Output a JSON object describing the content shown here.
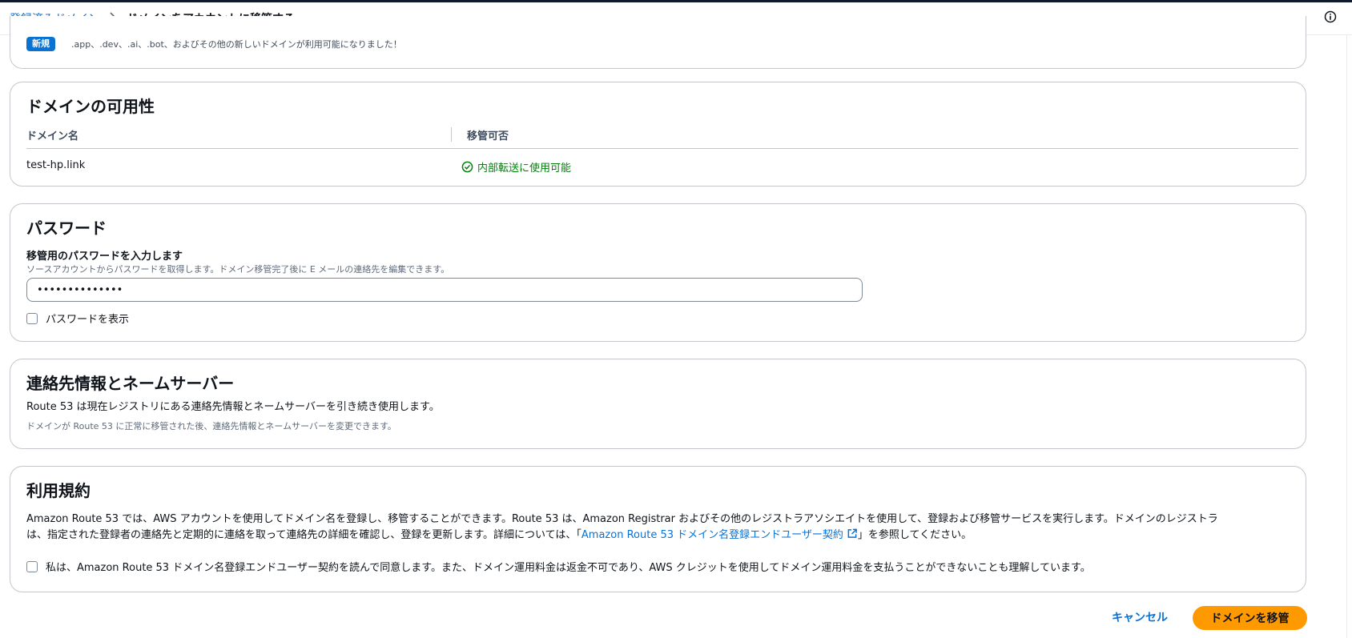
{
  "breadcrumb": {
    "parent": "登録済みドメイン",
    "current": "ドメインをアカウントに移管する"
  },
  "icons": {
    "info": "info-icon",
    "chevron": "chevron-right-icon",
    "status_ok": "check-circle-icon",
    "external": "external-link-icon"
  },
  "colors": {
    "accent": "#0972d3",
    "success": "#037f0c",
    "primary_button": "#ff9900"
  },
  "announcement": {
    "badge": "新規",
    "text": ".app、.dev、.ai、.bot、およびその他の新しいドメインが利用可能になりました！"
  },
  "availability": {
    "title": "ドメインの可用性",
    "columns": [
      "ドメイン名",
      "移管可否"
    ],
    "rows": [
      {
        "domain": "test-hp.link",
        "status": "内部転送に使用可能"
      }
    ]
  },
  "password": {
    "title": "パスワード",
    "label": "移管用のパスワードを入力します",
    "description": "ソースアカウントからパスワードを取得します。ドメイン移管完了後に E メールの連絡先を編集できます。",
    "value": "••••••••••••••",
    "show_label": "パスワードを表示"
  },
  "contacts": {
    "title": "連絡先情報とネームサーバー",
    "text": "Route 53 は現在レジストリにある連絡先情報とネームサーバーを引き続き使用します。",
    "note": "ドメインが Route 53 に正常に移管された後、連絡先情報とネームサーバーを変更できます。"
  },
  "terms": {
    "title": "利用規約",
    "line1": "Amazon Route 53 では、AWS アカウントを使用してドメイン名を登録し、移管することができます。Route 53 は、Amazon Registrar およびその他のレジストラアソシエイトを使用して、登録および移管サービスを実行します。ドメインのレジストラ",
    "line2_prefix": "は、指定された登録者の連絡先と定期的に連絡を取って連絡先の詳細を確認し、登録を更新します。詳細については、「",
    "link": "Amazon Route 53 ドメイン名登録エンドユーザー契約",
    "line2_suffix": "」を参照してください。",
    "agree": "私は、Amazon Route 53 ドメイン名登録エンドユーザー契約を読んで同意します。また、ドメイン運用料金は返金不可であり、AWS クレジットを使用してドメイン運用料金を支払うことができないことも理解しています。"
  },
  "actions": {
    "cancel": "キャンセル",
    "submit": "ドメインを移管"
  }
}
